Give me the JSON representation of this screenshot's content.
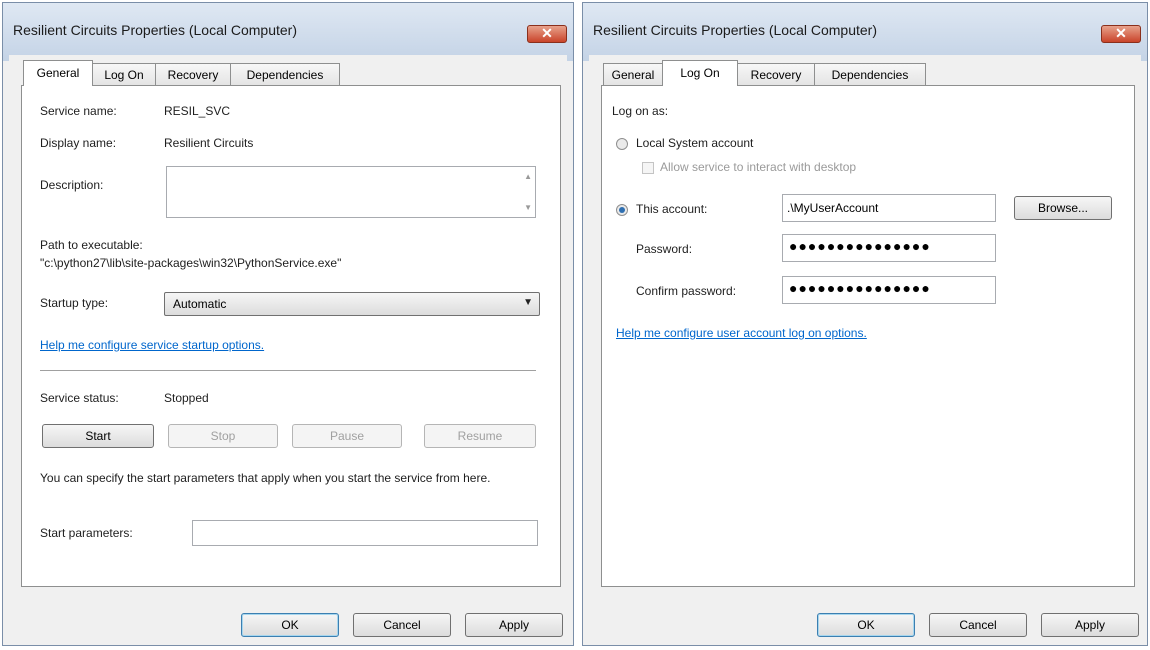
{
  "windows": [
    {
      "title": "Resilient Circuits Properties (Local Computer)",
      "tabs": [
        "General",
        "Log On",
        "Recovery",
        "Dependencies"
      ],
      "active_tab": "General",
      "general": {
        "service_name_label": "Service name:",
        "service_name_value": "RESIL_SVC",
        "display_name_label": "Display name:",
        "display_name_value": "Resilient Circuits",
        "description_label": "Description:",
        "description_value": "",
        "path_label": "Path to executable:",
        "path_value": "\"c:\\python27\\lib\\site-packages\\win32\\PythonService.exe\"",
        "startup_type_label": "Startup type:",
        "startup_type_value": "Automatic",
        "help_link": "Help me configure service startup options.",
        "service_status_label": "Service status:",
        "service_status_value": "Stopped",
        "start_button": "Start",
        "stop_button": "Stop",
        "pause_button": "Pause",
        "resume_button": "Resume",
        "start_params_info": "You can specify the start parameters that apply when you start the service from here.",
        "start_params_label": "Start parameters:",
        "start_params_value": ""
      },
      "footer": {
        "ok": "OK",
        "cancel": "Cancel",
        "apply": "Apply"
      }
    },
    {
      "title": "Resilient Circuits Properties (Local Computer)",
      "tabs": [
        "General",
        "Log On",
        "Recovery",
        "Dependencies"
      ],
      "active_tab": "Log On",
      "logon": {
        "log_on_as_label": "Log on as:",
        "local_system_label": "Local System account",
        "allow_interact_label": "Allow service to interact with desktop",
        "this_account_label": "This account:",
        "this_account_value": ".\\MyUserAccount",
        "browse_button": "Browse...",
        "password_label": "Password:",
        "password_value": "●●●●●●●●●●●●●●●",
        "confirm_password_label": "Confirm password:",
        "confirm_password_value": "●●●●●●●●●●●●●●●",
        "help_link": "Help me configure user account log on options."
      },
      "footer": {
        "ok": "OK",
        "cancel": "Cancel",
        "apply": "Apply"
      }
    }
  ],
  "colors": {
    "link": "#0066cc",
    "close_button": "#c9442a",
    "titlebar": "#c4d3e6"
  }
}
